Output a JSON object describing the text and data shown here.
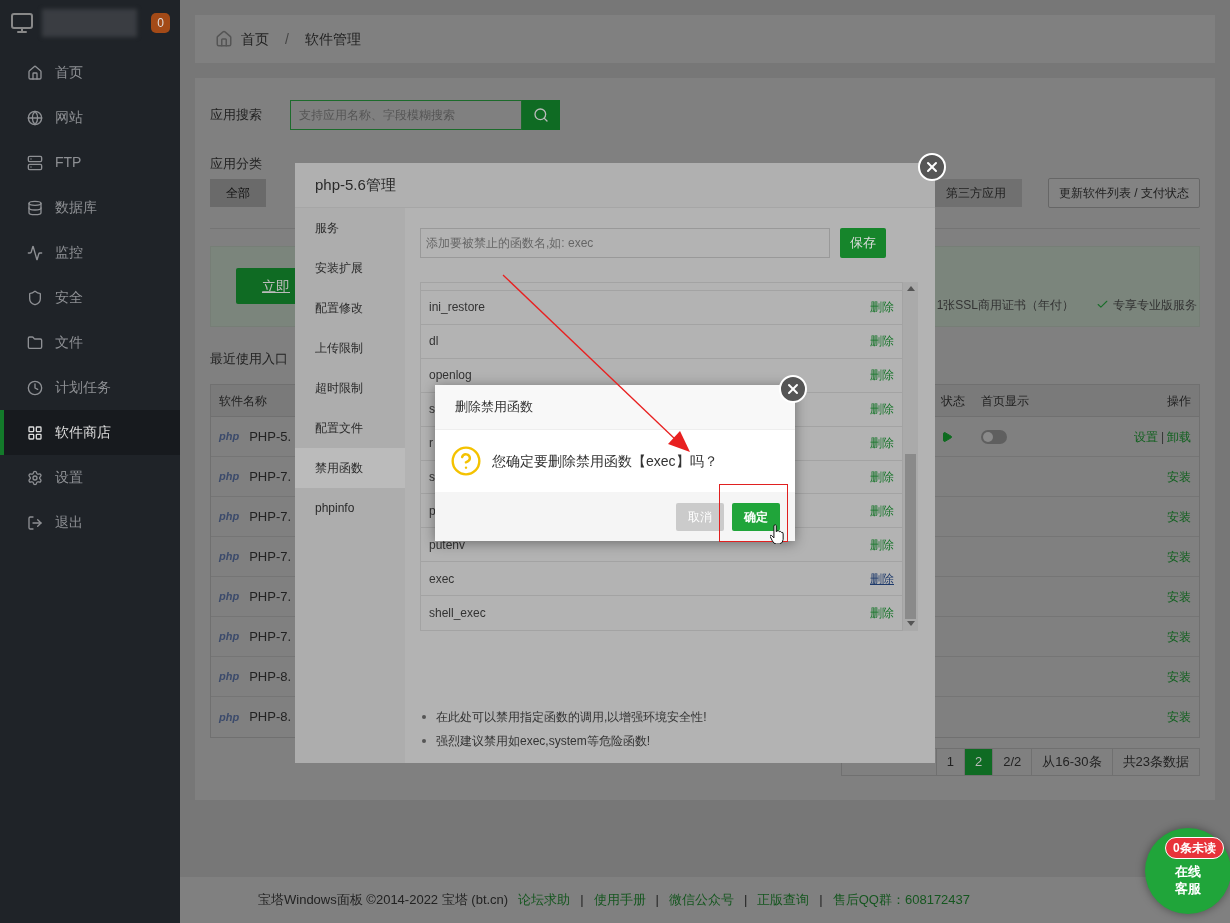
{
  "sidebar": {
    "badge": "0",
    "items": [
      {
        "label": "首页",
        "selected": false
      },
      {
        "label": "网站",
        "selected": false
      },
      {
        "label": "FTP",
        "selected": false
      },
      {
        "label": "数据库",
        "selected": false
      },
      {
        "label": "监控",
        "selected": false
      },
      {
        "label": "安全",
        "selected": false
      },
      {
        "label": "文件",
        "selected": false
      },
      {
        "label": "计划任务",
        "selected": false
      },
      {
        "label": "软件商店",
        "selected": true
      },
      {
        "label": "设置",
        "selected": false
      },
      {
        "label": "退出",
        "selected": false
      }
    ]
  },
  "breadcrumb": {
    "items": [
      "首页",
      "软件管理"
    ],
    "separator": "/"
  },
  "search": {
    "label": "应用搜索",
    "placeholder": "支持应用名称、字段模糊搜索"
  },
  "categories": {
    "label": "应用分类",
    "items": [
      {
        "label": "全部",
        "selected": true
      },
      {
        "label": "第三方应用",
        "selected": false
      }
    ],
    "refresh_button": "更新软件列表 / 支付状态"
  },
  "promo": {
    "button": "立即",
    "features": [
      {
        "text": "1张SSL商用证书（年付）"
      },
      {
        "text": "专享专业版服务",
        "check": true
      }
    ]
  },
  "recent_label": "最近使用入口",
  "table": {
    "columns": [
      "软件名称",
      "状态",
      "首页显示",
      "操作"
    ],
    "rows": [
      {
        "kind": "installed",
        "logo": "php",
        "name": "PHP-5.",
        "running": true,
        "homepage": false,
        "actions": [
          "设置",
          "卸载"
        ],
        "separator": "|"
      },
      {
        "kind": "available",
        "logo": "php",
        "name": "PHP-7.",
        "actions": [
          "安装"
        ]
      },
      {
        "kind": "available",
        "logo": "php",
        "name": "PHP-7.",
        "actions": [
          "安装"
        ]
      },
      {
        "kind": "available",
        "logo": "php",
        "name": "PHP-7.",
        "actions": [
          "安装"
        ]
      },
      {
        "kind": "available",
        "logo": "php",
        "name": "PHP-7.",
        "actions": [
          "安装"
        ]
      },
      {
        "kind": "available",
        "logo": "php",
        "name": "PHP-7.",
        "actions": [
          "安装"
        ]
      },
      {
        "kind": "available",
        "logo": "php",
        "name": "PHP-8.",
        "actions": [
          "安装"
        ]
      },
      {
        "kind": "available",
        "logo": "php",
        "name": "PHP-8.",
        "actions": [
          "安装"
        ]
      }
    ]
  },
  "pagination": [
    {
      "label": "1",
      "selected": false
    },
    {
      "label": "2",
      "selected": true
    },
    {
      "label": "2/2",
      "selected": false
    },
    {
      "label": "从16-30条",
      "selected": false
    },
    {
      "label": "共23条数据",
      "selected": false
    }
  ],
  "modal": {
    "title": "php-5.6管理",
    "menu": [
      {
        "label": "服务",
        "selected": false
      },
      {
        "label": "安装扩展",
        "selected": false
      },
      {
        "label": "配置修改",
        "selected": false
      },
      {
        "label": "上传限制",
        "selected": false
      },
      {
        "label": "超时限制",
        "selected": false
      },
      {
        "label": "配置文件",
        "selected": false
      },
      {
        "label": "禁用函数",
        "selected": true
      },
      {
        "label": "phpinfo",
        "selected": false
      }
    ],
    "input_placeholder": "添加要被禁止的函数名,如: exec",
    "save_button": "保存",
    "functions": [
      {
        "name": "ini_restore",
        "action": "删除",
        "hovered": false
      },
      {
        "name": "dl",
        "action": "删除",
        "hovered": false
      },
      {
        "name": "openlog",
        "action": "删除",
        "hovered": false
      },
      {
        "name": "s",
        "action": "删除",
        "hovered": false
      },
      {
        "name": "r",
        "action": "删除",
        "hovered": false
      },
      {
        "name": "s",
        "action": "删除",
        "hovered": false
      },
      {
        "name": "p",
        "action": "删除",
        "hovered": false
      },
      {
        "name": "putenv",
        "action": "删除",
        "hovered": false
      },
      {
        "name": "exec",
        "action": "删除",
        "hovered": true
      },
      {
        "name": "shell_exec",
        "action": "删除",
        "hovered": false
      }
    ],
    "notes": [
      "在此处可以禁用指定函数的调用,以增强环境安全性!",
      "强烈建议禁用如exec,system等危险函数!"
    ]
  },
  "confirm": {
    "title": "删除禁用函数",
    "message": "您确定要删除禁用函数【exec】吗？",
    "cancel": "取消",
    "ok": "确定"
  },
  "chat": {
    "label": "在线客服",
    "badge": "0条未读"
  },
  "footer": {
    "copyright": "宝塔Windows面板 ©2014-2022 宝塔 (bt.cn)",
    "separator": "|",
    "links": [
      "论坛求助",
      "使用手册",
      "微信公众号",
      "正版查询",
      "售后QQ群：608172437"
    ]
  }
}
